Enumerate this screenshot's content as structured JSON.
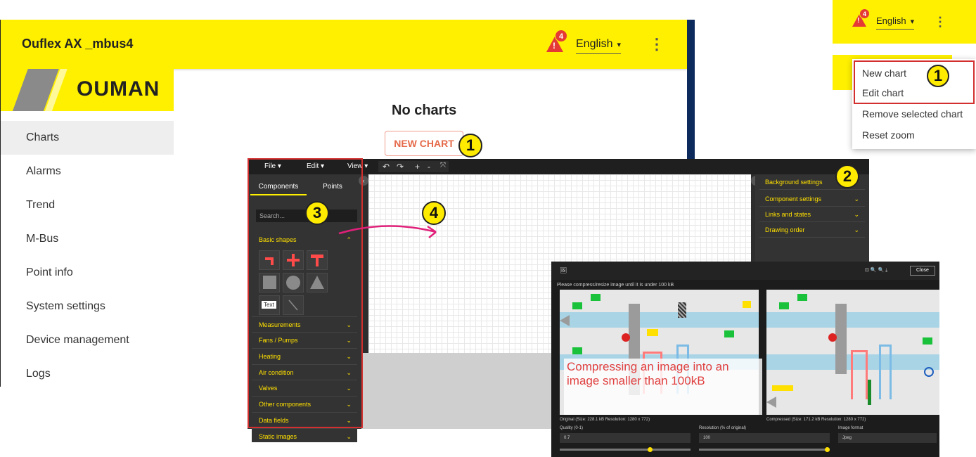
{
  "app": {
    "title": "Ouflex AX _mbus4",
    "alert_count": "4",
    "alert_mark": "!",
    "language": "English",
    "language_caret": "▾",
    "kebab": "⋮",
    "logo": "OUMAN",
    "nav": [
      "Charts",
      "Alarms",
      "Trend",
      "M-Bus",
      "Point info",
      "System settings",
      "Device management",
      "Logs"
    ],
    "active_nav": "Charts",
    "empty_title": "No charts",
    "new_chart_button": "NEW CHART"
  },
  "steps": {
    "one": "1",
    "two": "2",
    "three": "3",
    "four": "4"
  },
  "menu": {
    "alert_count": "4",
    "language": "English",
    "items": [
      "New chart",
      "Edit chart",
      "Remove selected chart",
      "Reset zoom"
    ]
  },
  "editor": {
    "menus": {
      "file": "File ▾",
      "edit": "Edit ▾",
      "view": "View ▾"
    },
    "tools": {
      "undo": "↶",
      "redo": "↷",
      "zoom_in": "+",
      "zoom_out": "-",
      "fit": "⤧"
    },
    "tabs": {
      "components": "Components",
      "points": "Points"
    },
    "search_placeholder": "Search...",
    "basic_shapes": "Basic shapes",
    "text_tool": "Text",
    "sections": [
      "Measurements",
      "Fans / Pumps",
      "Heating",
      "Air condition",
      "Valves",
      "Other components",
      "Data fields",
      "Static images"
    ],
    "right_sections": [
      "Background settings",
      "Component settings",
      "Links and states",
      "Drawing order"
    ],
    "collapse_left": "‹",
    "collapse_right": "›",
    "chevron_up": "⌃",
    "chevron_down": "⌄"
  },
  "compress": {
    "header_icon": "🖼",
    "header_tools": "⊡  🔍  🔍  ⤓",
    "close": "Close",
    "message": "Please compress/resize image until it is under 100 kB",
    "caption": "Compressing an image into an image smaller than 100kB",
    "original_info": "Original (Size: 228.1 kB Resolution: 1280 x 772)",
    "compressed_info": "Compressed (Size: 171.2 kB Resolution: 1280 x 772)",
    "quality_label": "Quality (0-1)",
    "quality_value": "0.7",
    "resolution_label": "Resolution (% of original)",
    "resolution_value": "100",
    "format_label": "Image format",
    "format_value": "Jpeg",
    "quality_slider": 0.7,
    "resolution_slider": 1.0
  },
  "colors": {
    "brand_yellow": "#fff000",
    "alert_red": "#e53935",
    "accent_orange": "#e56a4a",
    "highlight_red": "#d32f2f",
    "arrow_pink": "#e0207a"
  }
}
